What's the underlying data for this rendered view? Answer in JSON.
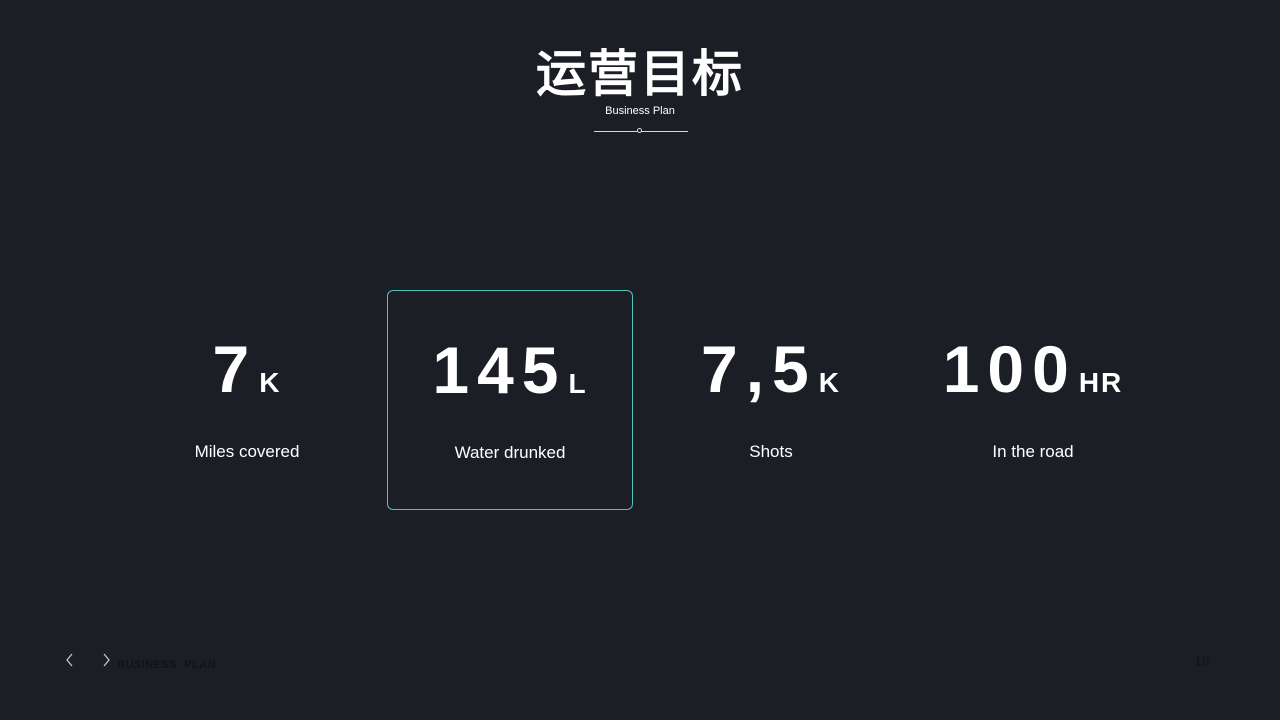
{
  "slide": {
    "title": "运营目标",
    "subtitle": "Business Plan"
  },
  "stats": [
    {
      "number": "7",
      "unit": "K",
      "label": "Miles covered",
      "highlighted": false
    },
    {
      "number": "145",
      "unit": "L",
      "label": "Water drunked",
      "highlighted": true
    },
    {
      "number": "7,5",
      "unit": "K",
      "label": "Shots",
      "highlighted": false
    },
    {
      "number": "100",
      "unit": "HR",
      "label": "In the road",
      "highlighted": false
    }
  ],
  "footer": {
    "prev_icon": "chevron-left-icon",
    "next_icon": "chevron-right-icon",
    "text": "BUSINESS  PLAN",
    "page_number": "18"
  },
  "colors": {
    "background": "#1c1e26",
    "highlight_border": "#4fc3c0",
    "text": "#ffffff"
  }
}
